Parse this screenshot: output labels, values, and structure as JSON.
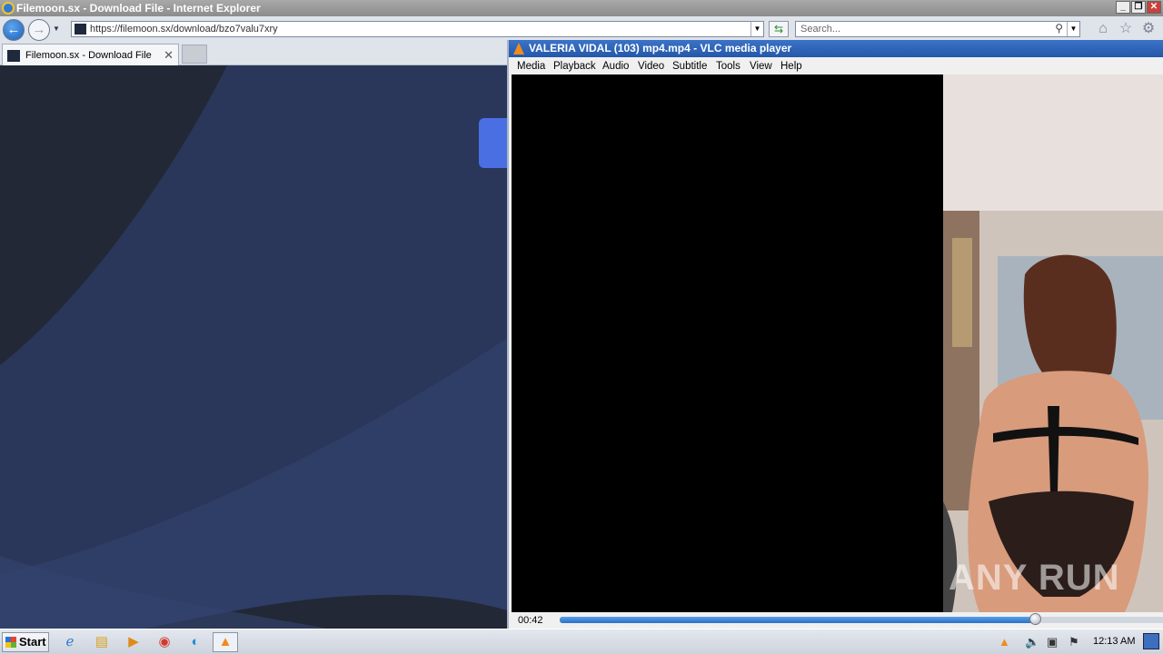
{
  "browser": {
    "window_title": "Filemoon.sx - Download File - Internet Explorer",
    "url": "https://filemoon.sx/download/bzo7valu7xry",
    "search_placeholder": "Search...",
    "tabs": [
      {
        "label": "Filemoon.sx - Download File"
      }
    ],
    "toolbar_icons": [
      "home-icon",
      "favorites-star-icon",
      "settings-gear-icon"
    ]
  },
  "vlc": {
    "window_title": "VALERIA VIDAL (103) mp4.mp4 - VLC media player",
    "menu": [
      "Media",
      "Playback",
      "Audio",
      "Video",
      "Subtitle",
      "Tools",
      "View",
      "Help"
    ],
    "elapsed": "00:42",
    "progress_fraction": 0.785,
    "watermark": "ANY RUN"
  },
  "taskbar": {
    "start_label": "Start",
    "apps": [
      "internet-explorer-icon",
      "file-explorer-icon",
      "media-player-icon",
      "chrome-icon",
      "edge-icon",
      "vlc-icon"
    ],
    "clock": "12:13 AM"
  },
  "colors": {
    "page_bg": "#222836",
    "page_wave": "#2c3a60",
    "accent_button": "#4a6fe3",
    "vlc_title": "#2458a9"
  }
}
